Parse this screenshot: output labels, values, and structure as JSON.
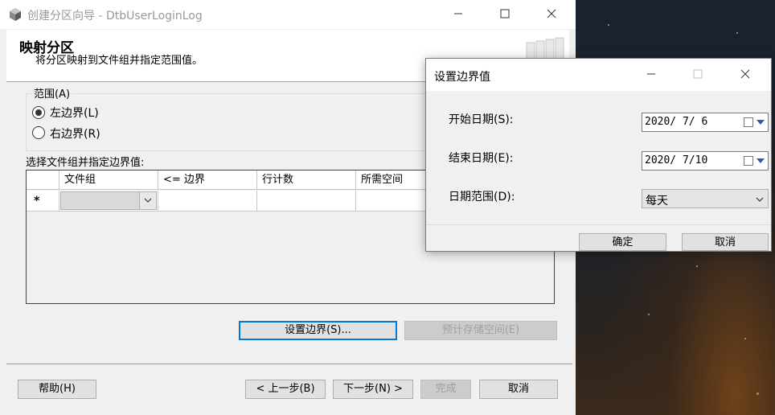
{
  "wizard": {
    "title": "创建分区向导 - DtbUserLoginLog",
    "header_title": "映射分区",
    "header_subtitle": "将分区映射到文件组并指定范围值。",
    "range_group_label": "范围(A)",
    "radio_left": "左边界(L)",
    "radio_right": "右边界(R)",
    "radio_selected": "left",
    "grid_label": "选择文件组并指定边界值:",
    "grid_columns": [
      "文件组",
      "<= 边界",
      "行计数",
      "所需空间"
    ],
    "new_row_marker": "*",
    "set_boundaries_button": "设置边界(S)...",
    "estimate_storage_button": "预计存储空间(E)",
    "help_button": "帮助(H)",
    "prev_button": "< 上一步(B)",
    "next_button": "下一步(N) >",
    "finish_button": "完成",
    "cancel_button": "取消"
  },
  "dialog": {
    "title": "设置边界值",
    "start_date_label": "开始日期(S):",
    "start_date_value": "2020/ 7/ 6",
    "end_date_label": "结束日期(E):",
    "end_date_value": "2020/ 7/10",
    "date_range_label": "日期范围(D):",
    "date_range_value": "每天",
    "ok_button": "确定",
    "cancel_button": "取消"
  },
  "colors": {
    "accent": "#0078d7",
    "window_bg": "#f0f0f0"
  }
}
